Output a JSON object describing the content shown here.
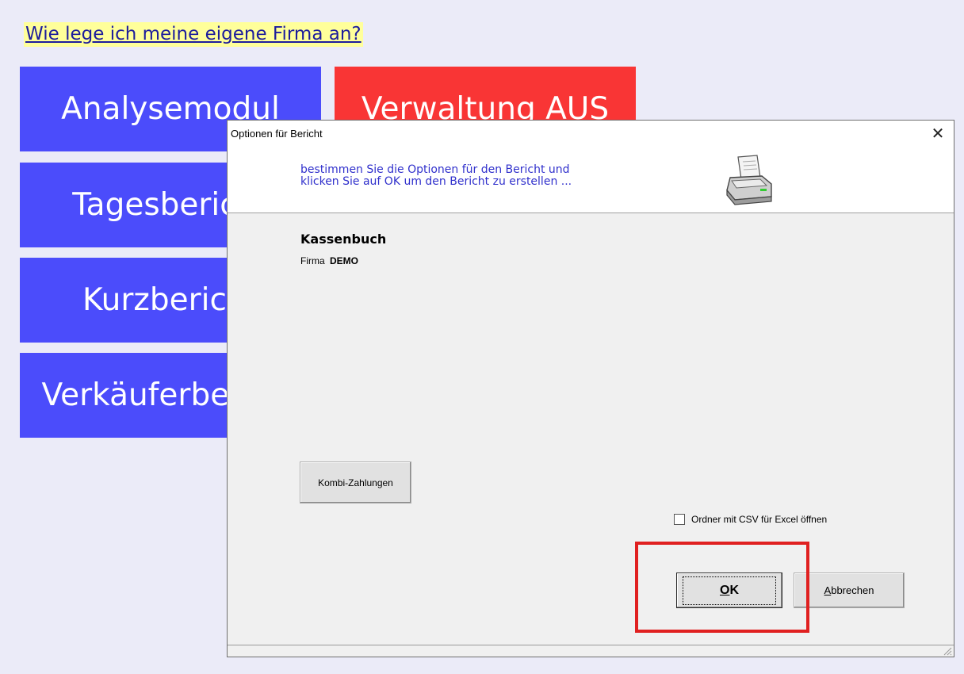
{
  "help_link": "Wie lege ich meine eigene Firma an?",
  "tiles": [
    {
      "label": "Analysemodul",
      "color": "#4b4cfb"
    },
    {
      "label": "Verwaltung AUS",
      "color": "#f93535"
    },
    {
      "label": "Tagesbericht",
      "color": "#4b4cfb"
    },
    {
      "label": "Kurzbericht",
      "color": "#4b4cfb"
    },
    {
      "label": "Verkäuferbericht",
      "color": "#4b4cfb"
    }
  ],
  "dialog": {
    "title": "Optionen für Bericht",
    "instructions_line1": "bestimmen Sie die Optionen für den Bericht und",
    "instructions_line2": "klicken Sie auf OK um den Bericht zu erstellen ...",
    "report_name": "Kassenbuch",
    "firma_label": "Firma",
    "firma_value": "DEMO",
    "kombi_button": "Kombi-Zahlungen",
    "csv_checkbox_label": "Ordner mit CSV für Excel öffnen",
    "csv_checked": false,
    "ok_mnemonic": "O",
    "ok_rest": "K",
    "cancel_mnemonic": "A",
    "cancel_rest": "bbrechen"
  },
  "colors": {
    "highlight": "#e02020",
    "instructions_text": "#3030cc"
  }
}
